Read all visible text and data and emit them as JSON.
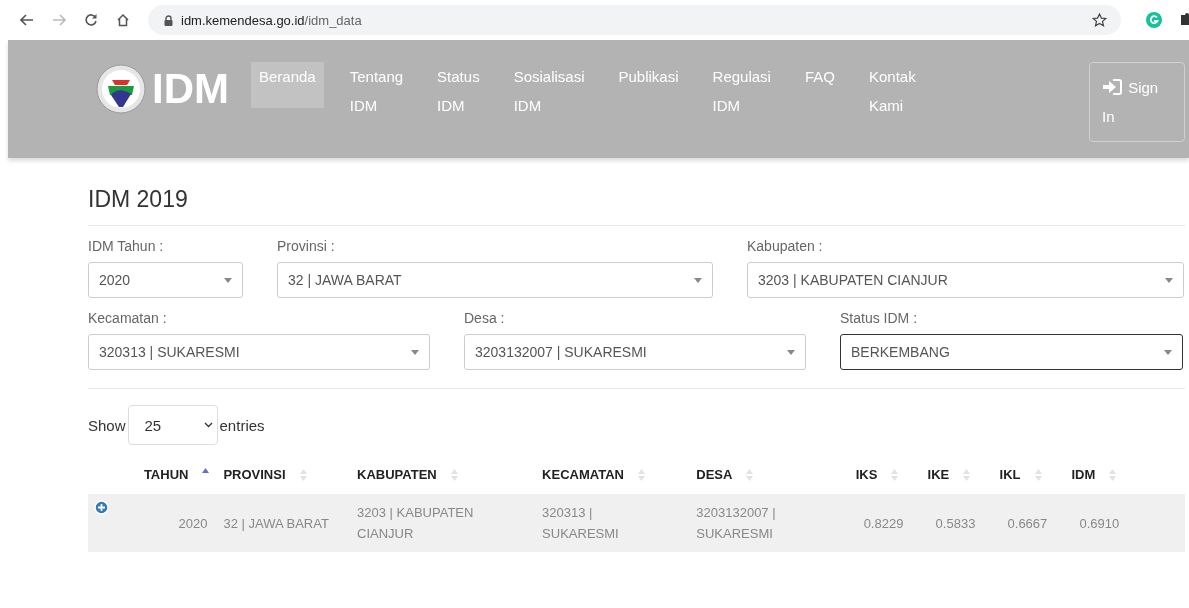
{
  "browser": {
    "url_host": "idm.kemendesa.go.id",
    "url_path": "/idm_data",
    "back_disabled": false,
    "forward_disabled": true,
    "bookmarked": false
  },
  "header": {
    "logo_text": "IDM",
    "nav": [
      {
        "label": "Beranda",
        "selected": true
      },
      {
        "label": "Tentang IDM",
        "selected": false
      },
      {
        "label": "Status IDM",
        "selected": false
      },
      {
        "label": "Sosialisasi IDM",
        "selected": false
      },
      {
        "label": "Publikasi",
        "selected": false
      },
      {
        "label": "Regulasi IDM",
        "selected": false
      },
      {
        "label": "FAQ",
        "selected": false
      },
      {
        "label": "Kontak Kami",
        "selected": false
      }
    ],
    "sign_in": "Sign In"
  },
  "title": "IDM 2019",
  "filter_rows": [
    [
      {
        "label": "IDM Tahun :",
        "value": "2020",
        "focused": false
      },
      {
        "label": "Provinsi :",
        "value": "32 | JAWA BARAT",
        "focused": false
      },
      {
        "label": "Kabupaten :",
        "value": "3203 | KABUPATEN CIANJUR",
        "focused": false
      }
    ],
    [
      {
        "label": "Kecamatan :",
        "value": "320313 | SUKARESMI",
        "focused": false
      },
      {
        "label": "Desa :",
        "value": "3203132007 | SUKARESMI",
        "focused": false
      },
      {
        "label": "Status IDM :",
        "value": "BERKEMBANG",
        "focused": true
      }
    ]
  ],
  "length": {
    "before": "Show",
    "value": "25",
    "after": "entries"
  },
  "table": {
    "columns": [
      {
        "label": "TAHUN",
        "sorted": true
      },
      {
        "label": "PROVINSI",
        "sorted": false
      },
      {
        "label": "KABUPATEN",
        "sorted": false
      },
      {
        "label": "KECAMATAN",
        "sorted": false
      },
      {
        "label": "DESA",
        "sorted": false
      },
      {
        "label": "IKS",
        "sorted": false
      },
      {
        "label": "IKE",
        "sorted": false
      },
      {
        "label": "IKL",
        "sorted": false
      },
      {
        "label": "IDM",
        "sorted": false
      }
    ],
    "rows": [
      {
        "expanded": false,
        "cells": [
          "2020",
          "32 | JAWA BARAT",
          "3203 | KABUPATEN CIANJUR",
          "320313 | SUKARESMI",
          "3203132007 | SUKARESMI",
          "0.8229",
          "0.5833",
          "0.6667",
          "0.6910"
        ]
      }
    ]
  }
}
